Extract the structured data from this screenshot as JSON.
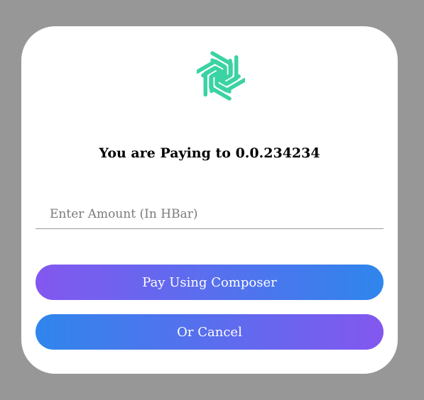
{
  "modal": {
    "logo_icon": "hedera-spiral-logo-icon",
    "logo_color": "#3bd3a3",
    "title": "You are Paying to 0.0.234234",
    "amount_input": {
      "placeholder": "Enter Amount (In HBar)",
      "value": ""
    },
    "pay_button": {
      "label": "Pay Using Composer",
      "gradient": [
        "#8357ef",
        "#2f86ec"
      ]
    },
    "cancel_button": {
      "label": "Or Cancel",
      "gradient": [
        "#2f86ec",
        "#8357ef"
      ]
    }
  },
  "colors": {
    "backdrop": "#979797",
    "modal_background": "#ffffff"
  }
}
